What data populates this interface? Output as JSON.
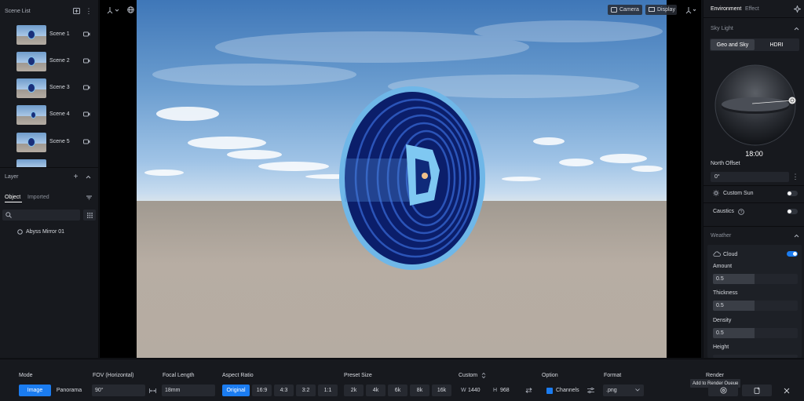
{
  "left_panel": {
    "scene_list_title": "Scene List",
    "scenes": [
      "Scene 1",
      "Scene 2",
      "Scene 3",
      "Scene 4",
      "Scene 5"
    ],
    "layer_title": "Layer",
    "tabs": [
      "Object",
      "Imported"
    ],
    "active_tab": "Object",
    "objects": [
      "Abyss Mirror 01"
    ]
  },
  "viewport": {
    "camera_label": "Camera",
    "display_label": "Display"
  },
  "right_panel": {
    "tabs": [
      "Environment",
      "Effect"
    ],
    "active_tab": "Environment",
    "sky_light_title": "Sky Light",
    "sky_modes": [
      "Geo and Sky",
      "HDRI"
    ],
    "active_sky_mode": "Geo and Sky",
    "time": "18:00",
    "north_offset_label": "North Offset",
    "north_offset_value": "0°",
    "custom_sun_label": "Custom Sun",
    "custom_sun_on": false,
    "caustics_label": "Caustics",
    "caustics_on": false,
    "weather_title": "Weather",
    "cloud_label": "Cloud",
    "cloud_on": true,
    "amount_label": "Amount",
    "amount_value": "0.5",
    "thickness_label": "Thickness",
    "thickness_value": "0.5",
    "density_label": "Density",
    "density_value": "0.5",
    "height_label": "Height"
  },
  "bottom_bar": {
    "mode_label": "Mode",
    "mode_options": [
      "Image",
      "Panorama"
    ],
    "active_mode": "Image",
    "fov_label": "FOV (Horizontal)",
    "fov_value": "90°",
    "focal_label": "Focal Length",
    "focal_value": "18mm",
    "aspect_label": "Aspect Ratio",
    "aspect_options": [
      "Original",
      "16:9",
      "4:3",
      "3:2",
      "1:1"
    ],
    "active_aspect": "Original",
    "preset_label": "Preset Size",
    "preset_options": [
      "2k",
      "4k",
      "6k",
      "8k",
      "16k"
    ],
    "custom_label": "Custom",
    "width_prefix": "W",
    "width_value": "1440",
    "height_prefix": "H",
    "height_value": "968",
    "option_label": "Option",
    "channels_label": "Channels",
    "format_label": "Format",
    "format_value": ".png",
    "render_label": "Render",
    "render_tooltip": "Add to Render Queue"
  },
  "colors": {
    "accent": "#1b7cf0",
    "panel_bg": "#17191e",
    "mirror_rim": "#6fb7e8",
    "mirror_inner": "#0b1e6a"
  }
}
